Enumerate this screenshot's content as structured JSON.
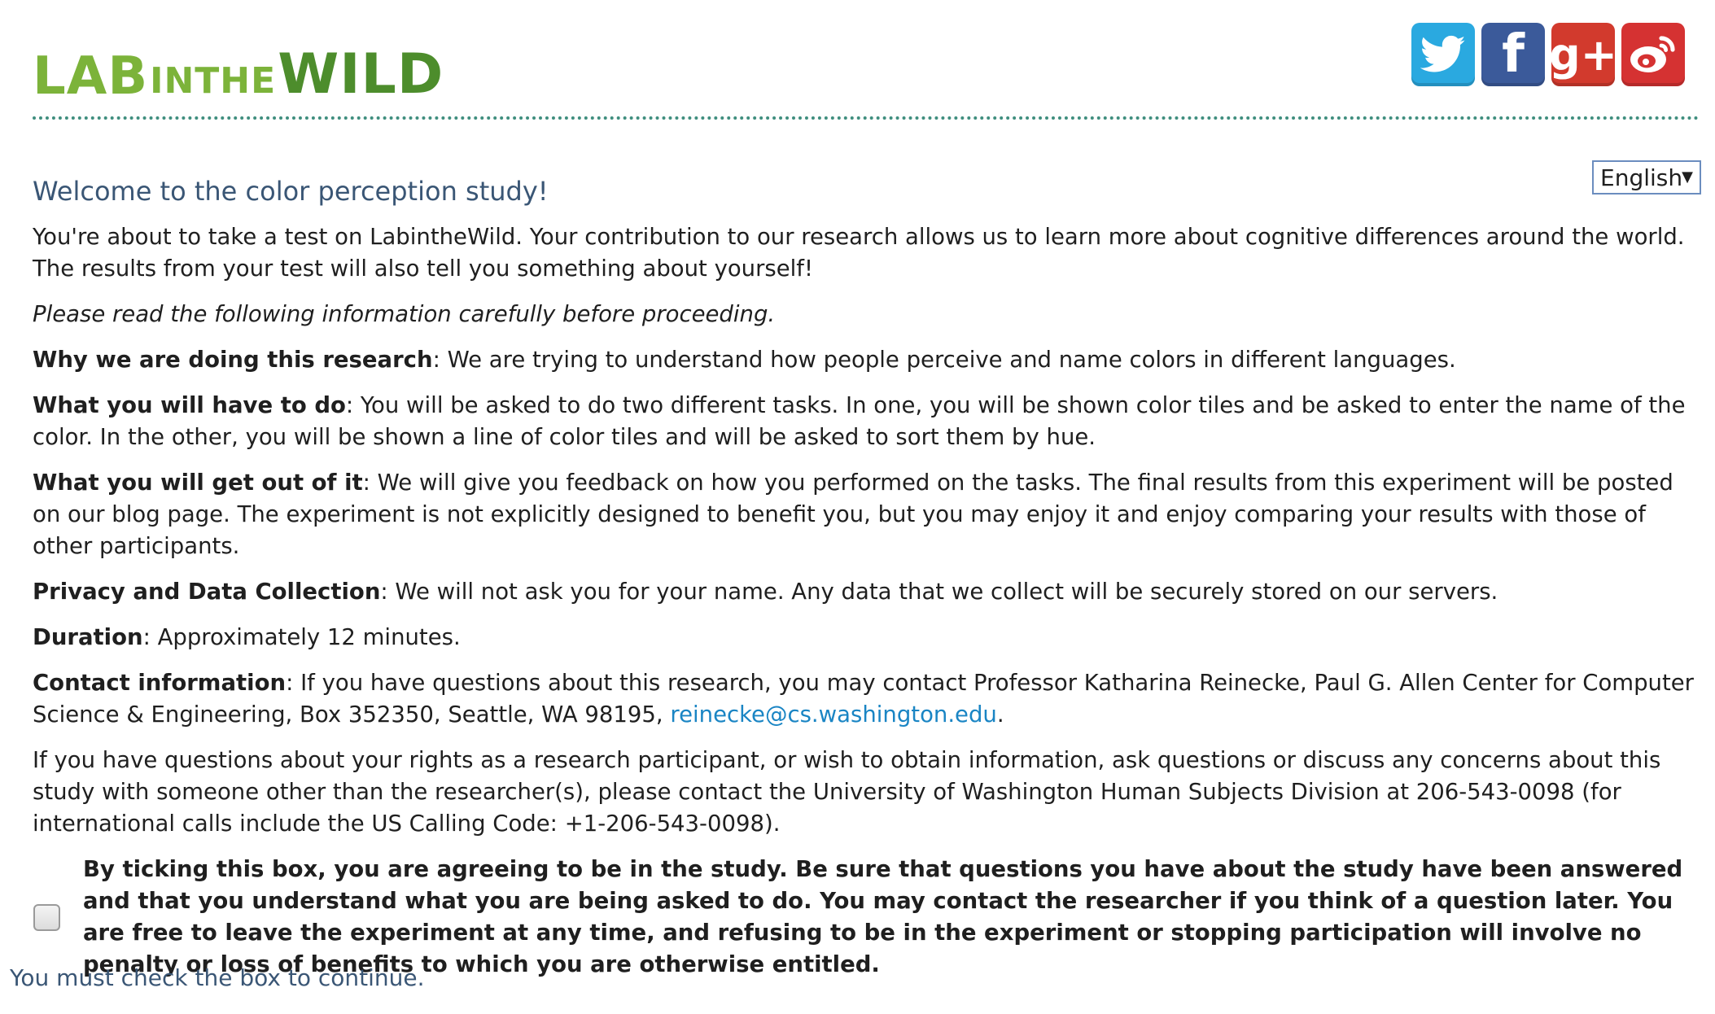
{
  "header": {
    "logo": {
      "part_lab": "LAB",
      "part_inthe": "INTHE",
      "part_wild": "WILD"
    },
    "social_links": [
      {
        "name": "twitter",
        "icon": "twitter-bird-icon",
        "color": "#2aa9e0"
      },
      {
        "name": "facebook",
        "icon": "facebook-f-icon",
        "glyph": "f",
        "color": "#3b5a9a"
      },
      {
        "name": "google-plus",
        "icon": "google-plus-icon",
        "glyph": "g+",
        "color": "#d23a2d"
      },
      {
        "name": "weibo",
        "icon": "weibo-eye-icon",
        "color": "#d53232"
      }
    ]
  },
  "language_select": {
    "selected": "English",
    "caret": "▼"
  },
  "main": {
    "welcome_title": "Welcome to the color perception study!",
    "intro": "You're about to take a test on LabintheWild. Your contribution to our research allows us to learn more about cognitive differences around the world. The results from your test will also tell you something about yourself!",
    "read_note": "Please read the following information carefully before proceeding.",
    "sections": [
      {
        "heading": "Why we are doing this research",
        "text": ": We are trying to understand how people perceive and name colors in different languages."
      },
      {
        "heading": "What you will have to do",
        "text": ": You will be asked to do two different tasks. In one, you will be shown color tiles and be asked to enter the name of the color. In the other, you will be shown a line of color tiles and will be asked to sort them by hue."
      },
      {
        "heading": "What you will get out of it",
        "text": ": We will give you feedback on how you performed on the tasks. The final results from this experiment will be posted on our blog page. The experiment is not explicitly designed to benefit you, but you may enjoy it and enjoy comparing your results with those of other participants."
      },
      {
        "heading": "Privacy and Data Collection",
        "text": ": We will not ask you for your name. Any data that we collect will be securely stored on our servers."
      },
      {
        "heading": "Duration",
        "text": ": Approximately 12 minutes."
      }
    ],
    "contact": {
      "heading": "Contact information",
      "text": ": If you have questions about this research, you may contact Professor Katharina Reinecke, Paul G. Allen Center for Computer Science & Engineering, Box 352350, Seattle, WA 98195, ",
      "email": "reinecke@cs.washington.edu",
      "trailing": "."
    },
    "rights_text": "If you have questions about your rights as a research participant, or wish to obtain information, ask questions or discuss any concerns about this study with someone other than the researcher(s), please contact the University of Washington Human Subjects Division at 206-543-0098 (for international calls include the US Calling Code: +1-206-543-0098).",
    "consent_text": "By ticking this box, you are agreeing to be in the study. Be sure that questions you have about the study have been answered and that you understand what you are being asked to do. You may contact the researcher if you think of a question later. You are free to leave the experiment at any time, and refusing to be in the experiment or stopping participation will involve no penalty or loss of benefits to which you are otherwise entitled.",
    "consent_checked": false,
    "warning": "You must check the box to continue."
  },
  "colors": {
    "title_blue": "#3a5675",
    "link_blue": "#1a85c4",
    "divider_green": "#3f8e7e",
    "logo_green": "#7cb33a",
    "logo_dark_green": "#4d8d2c"
  }
}
